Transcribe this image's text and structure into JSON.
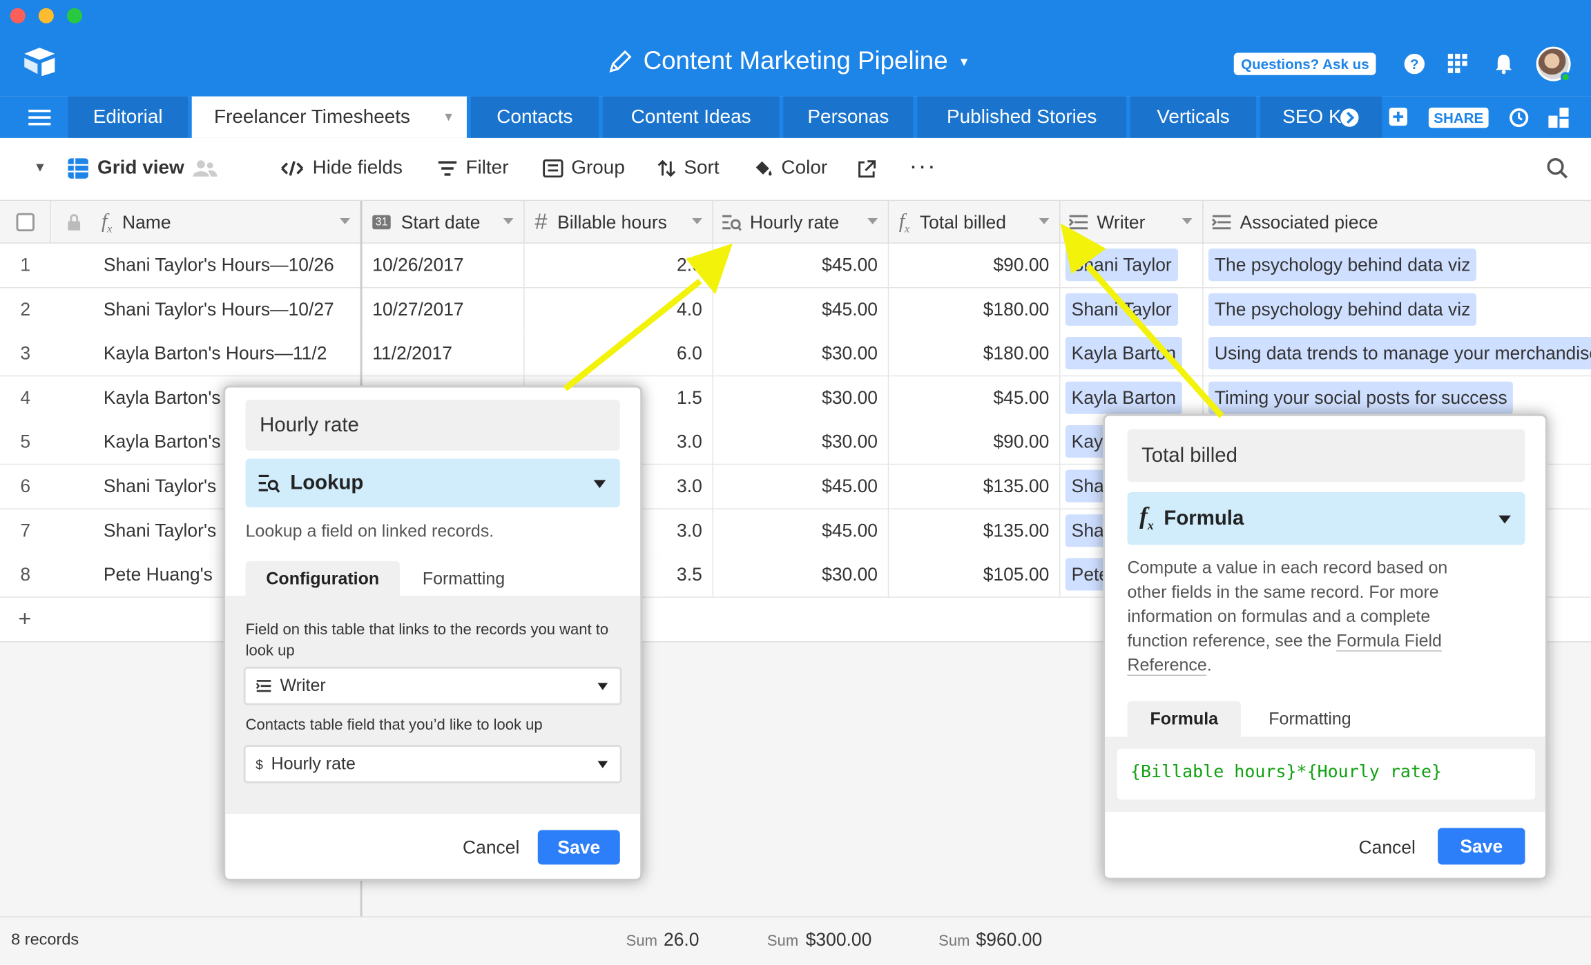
{
  "window": {
    "title": "Content Marketing Pipeline"
  },
  "header": {
    "ask_label": "Questions? Ask us",
    "share_label": "SHARE"
  },
  "tabs": [
    "Editorial",
    "Freelancer Timesheets",
    "Contacts",
    "Content Ideas",
    "Personas",
    "Published Stories",
    "Verticals",
    "SEO K"
  ],
  "toolbar": {
    "view_name": "Grid view",
    "hide_fields": "Hide fields",
    "filter": "Filter",
    "group": "Group",
    "sort": "Sort",
    "color": "Color"
  },
  "columns": [
    "Name",
    "Start date",
    "Billable hours",
    "Hourly rate",
    "Total billed",
    "Writer",
    "Associated piece"
  ],
  "rows": [
    {
      "n": "1",
      "name": "Shani Taylor's Hours—10/26",
      "date": "10/26/2017",
      "hours": "2.0",
      "rate": "$45.00",
      "total": "$90.00",
      "writer": "Shani Taylor",
      "piece": "The psychology behind data viz"
    },
    {
      "n": "2",
      "name": "Shani Taylor's Hours—10/27",
      "date": "10/27/2017",
      "hours": "4.0",
      "rate": "$45.00",
      "total": "$180.00",
      "writer": "Shani Taylor",
      "piece": "The psychology behind data viz"
    },
    {
      "n": "3",
      "name": "Kayla Barton's Hours—11/2",
      "date": "11/2/2017",
      "hours": "6.0",
      "rate": "$30.00",
      "total": "$180.00",
      "writer": "Kayla Barton",
      "piece": "Using data trends to manage your merchandise"
    },
    {
      "n": "4",
      "name": "Kayla Barton's",
      "date": "",
      "hours": "1.5",
      "rate": "$30.00",
      "total": "$45.00",
      "writer": "Kayla Barton",
      "piece": "Timing your social posts for success"
    },
    {
      "n": "5",
      "name": "Kayla Barton's",
      "date": "",
      "hours": "3.0",
      "rate": "$30.00",
      "total": "$90.00",
      "writer": "Kayla",
      "piece": ""
    },
    {
      "n": "6",
      "name": "Shani Taylor's",
      "date": "",
      "hours": "3.0",
      "rate": "$45.00",
      "total": "$135.00",
      "writer": "Shani",
      "piece": ""
    },
    {
      "n": "7",
      "name": "Shani Taylor's",
      "date": "",
      "hours": "3.0",
      "rate": "$45.00",
      "total": "$135.00",
      "writer": "Shani",
      "piece": ""
    },
    {
      "n": "8",
      "name": "Pete Huang's",
      "date": "",
      "hours": "3.5",
      "rate": "$30.00",
      "total": "$105.00",
      "writer": "Pete",
      "piece": ""
    }
  ],
  "footer": {
    "records": "8 records",
    "sum_label": "Sum",
    "sum_hours": "26.0",
    "sum_rate": "$300.00",
    "sum_total": "$960.00"
  },
  "lookup_popup": {
    "field_name": "Hourly rate",
    "type": "Lookup",
    "description": "Lookup a field on linked records.",
    "tab_config": "Configuration",
    "tab_format": "Formatting",
    "link_label": "Field on this table that links to the records you want to look up",
    "link_value": "Writer",
    "lookup_label": "Contacts table field that you’d like to look up",
    "lookup_value": "Hourly rate",
    "cancel": "Cancel",
    "save": "Save"
  },
  "formula_popup": {
    "field_name": "Total billed",
    "type": "Formula",
    "description_1": "Compute a value in each record based on",
    "description_2": "other fields in the same record. For more",
    "description_3": "information on formulas and a complete",
    "description_4": "function reference, see the",
    "description_link_1": "Formula Field",
    "description_link_2": "Reference",
    "tab_formula": "Formula",
    "tab_format": "Formatting",
    "formula": "{Billable hours}*{Hourly rate}",
    "cancel": "Cancel",
    "save": "Save"
  },
  "colors": {
    "brand": "#1d84e8",
    "save": "#2d7ff9",
    "chip": "#cfdfff",
    "type_bg": "#d1ecfb",
    "formula_text": "#11a011",
    "arrow": "#f2f20a"
  }
}
